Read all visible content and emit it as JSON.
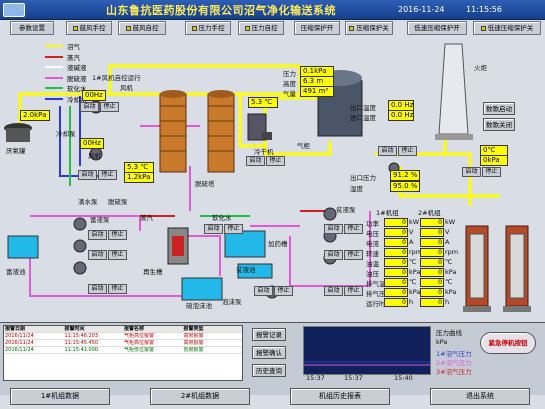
{
  "header": {
    "title": "山东鲁抗医药股份有限公司沼气净化输送系统",
    "date": "2016-11-24",
    "time": "11:15:56"
  },
  "toolbar": [
    {
      "label": "参数设置"
    },
    {
      "label": "鼓风手控"
    },
    {
      "label": "鼓风自控"
    },
    {
      "label": "压力手控"
    },
    {
      "label": "压力自控"
    },
    {
      "label": "压缩保护开"
    },
    {
      "label": "压缩保护关"
    },
    {
      "label": "低速压缩保护开"
    },
    {
      "label": "低速压缩保护关"
    }
  ],
  "legend": [
    {
      "label": "沼气",
      "color": "#ffff00"
    },
    {
      "label": "蒸汽",
      "color": "#d02020"
    },
    {
      "label": "液碱液",
      "color": "#ffffff"
    },
    {
      "label": "脱硫液",
      "color": "#e05ad8"
    },
    {
      "label": "软化水",
      "color": "#20c040"
    },
    {
      "label": "冷却水",
      "color": "#2a3cd0"
    }
  ],
  "labels": {
    "blower_note": "1#风机自控运行",
    "fan_label": "风机",
    "biogas_tank": "厌氧罐",
    "pump_water": "滴水泵",
    "pump_cool": "冷却泵",
    "pump_desulf": "脱硫泵",
    "desulf_tower": "脱硫塔",
    "cooler": "冷干机",
    "gas_holder": "气柜",
    "torch": "火炬",
    "rich_tank": "富液池",
    "rich_pump": "富液泵",
    "regen": "再生槽",
    "steam": "蒸汽",
    "soft_water": "软化水",
    "add_tank": "加药槽",
    "lean_tank": "贫液池",
    "sulfur_tank": "硫泡沫池",
    "foam_pump": "泡沫泵",
    "lean_pump": "贫液泵",
    "compressor1": "1#机组",
    "compressor2": "2#机组",
    "pressure_pic": "压力",
    "height": "高度",
    "volume": "气量",
    "out_temp": "出口温度",
    "in_temp": "进口温度",
    "out_press": "出口压力",
    "hum": "湿度",
    "pump_label": "压力"
  },
  "values": {
    "blower_hz1": "00Hz",
    "blower_hz2": "00Hz",
    "press_left": "2.0kPa",
    "temp_mid": "5.3 ℃",
    "press_tower": "1.2kPa",
    "press_holder": "0.1kPa",
    "height_holder": "6.3 m",
    "volume_holder": "491 m³",
    "temp_top": "0.0 Hz",
    "temp_top2": "0.0 Hz",
    "press_pipe": "91.2 %",
    "humidity": "95.0 %",
    "torch_temp": "0℃",
    "torch_press": "0kPa"
  },
  "buttons": {
    "start": "启动",
    "stop": "停止",
    "ignite": "数歌启动",
    "ignite_off": "数歌关闭"
  },
  "compressor_table": {
    "header1": "1#机组",
    "header2": "2#机组",
    "rows": [
      {
        "label": "功率",
        "v1": "0",
        "u1": "kW",
        "v2": "0",
        "u2": "kW"
      },
      {
        "label": "电压",
        "v1": "0",
        "u1": "V",
        "v2": "0",
        "u2": "V"
      },
      {
        "label": "电流",
        "v1": "0",
        "u1": "A",
        "v2": "0",
        "u2": "A"
      },
      {
        "label": "转速",
        "v1": "0",
        "u1": "rpm",
        "v2": "0",
        "u2": "rpm"
      },
      {
        "label": "油温",
        "v1": "0",
        "u1": "℃",
        "v2": "0",
        "u2": "℃"
      },
      {
        "label": "油压",
        "v1": "0",
        "u1": "kPa",
        "v2": "0",
        "u2": "kPa"
      },
      {
        "label": "排气温",
        "v1": "0",
        "u1": "℃",
        "v2": "0",
        "u2": "℃"
      },
      {
        "label": "排气压",
        "v1": "0",
        "u1": "kPa",
        "v2": "0",
        "u2": "kPa"
      },
      {
        "label": "运行时",
        "v1": "0",
        "u1": "h",
        "v2": "0",
        "u2": "h"
      }
    ]
  },
  "alarm": {
    "columns": [
      "报警日期",
      "报警时间",
      "报警名称",
      "报警类型"
    ],
    "rows": [
      {
        "date": "2016/11/24",
        "time": "11:15:46.203",
        "name": "气柜高位报警",
        "type": "高限报警"
      },
      {
        "date": "2016/11/24",
        "time": "11:15:45.450",
        "name": "气柜高位报警",
        "type": "高限报警"
      },
      {
        "date": "2016/11/24",
        "time": "11:15:41.000",
        "name": "气柜低位报警",
        "type": "低限报警"
      }
    ],
    "btn_record": "报警记录",
    "btn_confirm": "报警确认",
    "btn_history": "历史查询"
  },
  "trend": {
    "title": "压力曲线",
    "unit": "kPa",
    "t1": "15:37",
    "t2": "15:37",
    "t3": "15:40",
    "series": [
      "1#沼气压力",
      "2#沼气压力",
      "3#沼气压力"
    ]
  },
  "emergency": "紧急停机按钮",
  "bottom_nav": [
    {
      "label": "1#机组数据"
    },
    {
      "label": "2#机组数据"
    },
    {
      "label": "机组历史报表"
    },
    {
      "label": "退出系统"
    }
  ],
  "colors": {
    "biogas": "#ffff00",
    "steam": "#d02020",
    "liquid": "#e05ad8",
    "soft": "#20c040",
    "cool": "#2a3cd0",
    "vessel": "#c87a2a"
  }
}
